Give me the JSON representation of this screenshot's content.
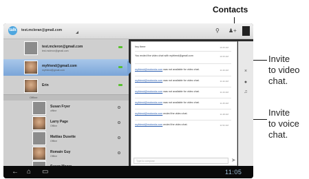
{
  "callouts": {
    "contacts": "Contacts",
    "invite_video": [
      "Invite",
      "to video",
      "chat."
    ],
    "invite_voice": [
      "Invite",
      "to voice",
      "chat."
    ]
  },
  "app": {
    "logo": "talk",
    "account": "test.mcleran@gmail.com"
  },
  "contacts": [
    {
      "name": "test.mcleron@gmail.com",
      "sub": "test.mcleron@gmail.com",
      "status": "online"
    },
    {
      "name": "myfriend@gmail.com",
      "sub": "myfriend@gmail.com",
      "status": "online",
      "selected": true
    },
    {
      "name": "Erin",
      "sub": "",
      "status": "online"
    }
  ],
  "offline_header": "Offline",
  "offline_contacts": [
    {
      "name": "Susan Fryer",
      "sub": "offline"
    },
    {
      "name": "Larry Page",
      "sub": "Offline"
    },
    {
      "name": "Mattias Dusette",
      "sub": "Offline"
    },
    {
      "name": "Romain Guy",
      "sub": "Offline"
    },
    {
      "name": "Susan Moore",
      "sub": "Offline"
    }
  ],
  "chat": {
    "messages": [
      {
        "text": "hey there",
        "time": "10:15 AM"
      },
      {
        "text": "You ended the video chat with myfriend@gmail.com",
        "time": "10:15 AM"
      },
      {
        "link": "myfriend@motorola.com",
        "text": " was not available for video chat.",
        "time": "11:40 AM"
      },
      {
        "link": "myfriend@motorola.com",
        "text": " was not available for video chat.",
        "time": "11:42 AM"
      },
      {
        "link": "myfriend@motorola.com",
        "text": " was not available for video chat.",
        "time": "11:43 AM"
      },
      {
        "link": "myfriend@motorola.com",
        "text": " was not available for video chat.",
        "time": "11:45 AM"
      },
      {
        "link": "myfriend@motorola.com",
        "text": " ended the video chat.",
        "time": "11:48 AM"
      },
      {
        "link": "myfriend@motorola.com",
        "text": " ended the video chat.",
        "time": "11:52 AM"
      }
    ],
    "compose_placeholder": "Type to compose"
  },
  "statusbar": {
    "time": "11:05"
  }
}
